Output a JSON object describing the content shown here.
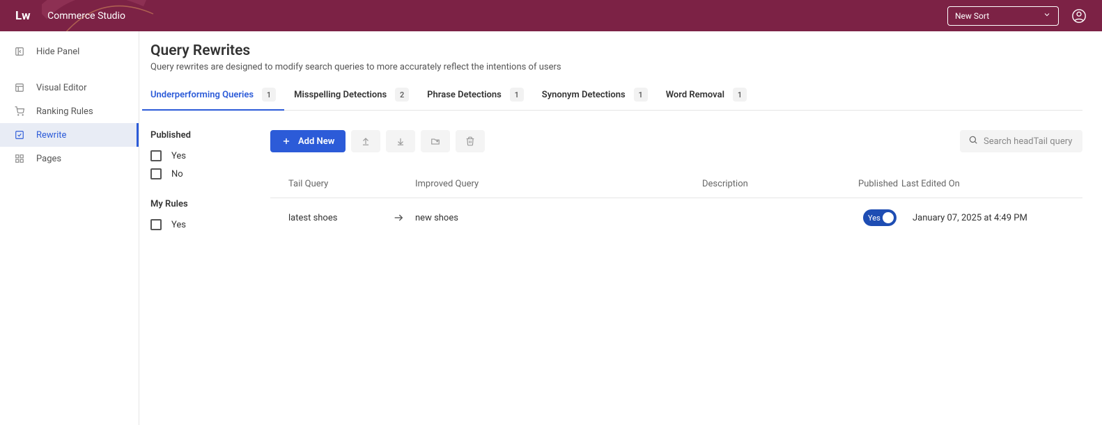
{
  "header": {
    "logo": "Lw",
    "app_name": "Commerce Studio",
    "select_label": "New Sort"
  },
  "sidebar": {
    "hide_panel": "Hide Panel",
    "items": [
      {
        "label": "Visual Editor"
      },
      {
        "label": "Ranking Rules"
      },
      {
        "label": "Rewrite"
      },
      {
        "label": "Pages"
      }
    ]
  },
  "page": {
    "title": "Query Rewrites",
    "description": "Query rewrites are designed to modify search queries to more accurately reflect the intentions of users"
  },
  "tabs": [
    {
      "label": "Underperforming Queries",
      "count": "1"
    },
    {
      "label": "Misspelling Detections",
      "count": "2"
    },
    {
      "label": "Phrase Detections",
      "count": "1"
    },
    {
      "label": "Synonym Detections",
      "count": "1"
    },
    {
      "label": "Word Removal",
      "count": "1"
    }
  ],
  "filters": {
    "published_title": "Published",
    "published_yes": "Yes",
    "published_no": "No",
    "myrules_title": "My Rules",
    "myrules_yes": "Yes"
  },
  "toolbar": {
    "add_new": "Add New",
    "search_placeholder": "Search headTail query"
  },
  "table": {
    "headers": {
      "tail": "Tail Query",
      "improved": "Improved Query",
      "description": "Description",
      "published": "Published",
      "edited": "Last Edited On"
    },
    "row": {
      "tail_query": "latest shoes",
      "improved_query": "new shoes",
      "description": "",
      "published_label": "Yes",
      "last_edited": "January 07, 2025 at 4:49 PM"
    }
  }
}
